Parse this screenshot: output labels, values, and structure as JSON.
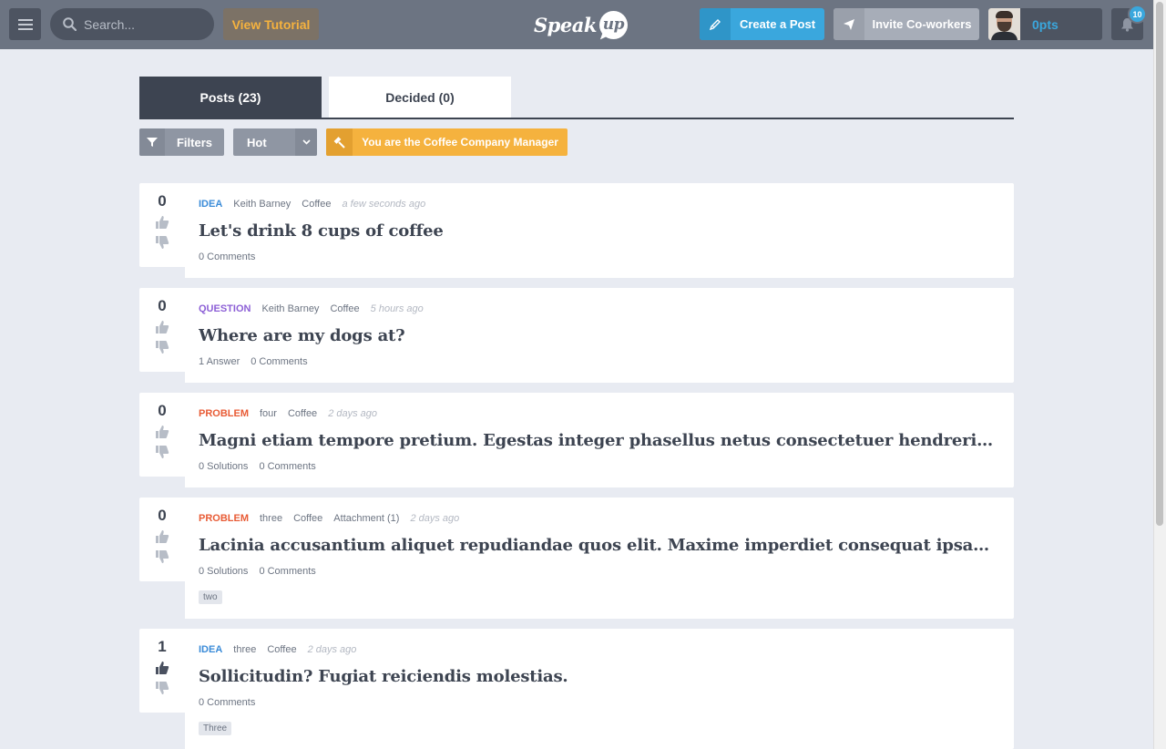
{
  "header": {
    "search_placeholder": "Search...",
    "tutorial_label": "View Tutorial",
    "logo_text": "Speak",
    "logo_bubble": "up",
    "create_post_label": "Create a Post",
    "invite_label": "Invite Co-workers",
    "points": "0pts",
    "notification_count": "10"
  },
  "tabs": [
    {
      "label": "Posts (23)"
    },
    {
      "label": "Decided (0)"
    }
  ],
  "toolbar": {
    "filters_label": "Filters",
    "sort_value": "Hot",
    "manager_prefix": "You are the ",
    "manager_company": "Coffee",
    "manager_suffix": " Company Manager"
  },
  "colors": {
    "accent": "#3aa7dd",
    "idea": "#3a8bd8",
    "question": "#8c5fd6",
    "problem": "#e85b35",
    "warning": "#f5b23e"
  },
  "posts": [
    {
      "votes": "0",
      "type": "IDEA",
      "author": "Keith Barney",
      "category": "Coffee",
      "time": "a few seconds ago",
      "title": "Let's drink 8 cups of coffee",
      "stats": [
        "0 Comments"
      ]
    },
    {
      "votes": "0",
      "type": "QUESTION",
      "author": "Keith Barney",
      "category": "Coffee",
      "time": "5 hours ago",
      "title": "Where are my dogs at?",
      "stats": [
        "1 Answer",
        "0 Comments"
      ]
    },
    {
      "votes": "0",
      "type": "PROBLEM",
      "author": "four",
      "category": "Coffee",
      "time": "2 days ago",
      "title": "Magni etiam tempore pretium. Egestas integer phasellus netus consectetuer hendrerit convallis dictum lorem",
      "stats": [
        "0 Solutions",
        "0 Comments"
      ]
    },
    {
      "votes": "0",
      "type": "PROBLEM",
      "author": "three",
      "category": "Coffee",
      "attachment": "Attachment (1)",
      "time": "2 days ago",
      "title": "Lacinia accusantium aliquet repudiandae quos elit. Maxime imperdiet consequat ipsam, aptent sapiente lorem",
      "stats": [
        "0 Solutions",
        "0 Comments"
      ],
      "tag": "two"
    },
    {
      "votes": "1",
      "type": "IDEA",
      "author": "three",
      "category": "Coffee",
      "time": "2 days ago",
      "title": "Sollicitudin? Fugiat reiciendis molestias.",
      "stats": [
        "0 Comments"
      ],
      "tag": "Three"
    }
  ]
}
